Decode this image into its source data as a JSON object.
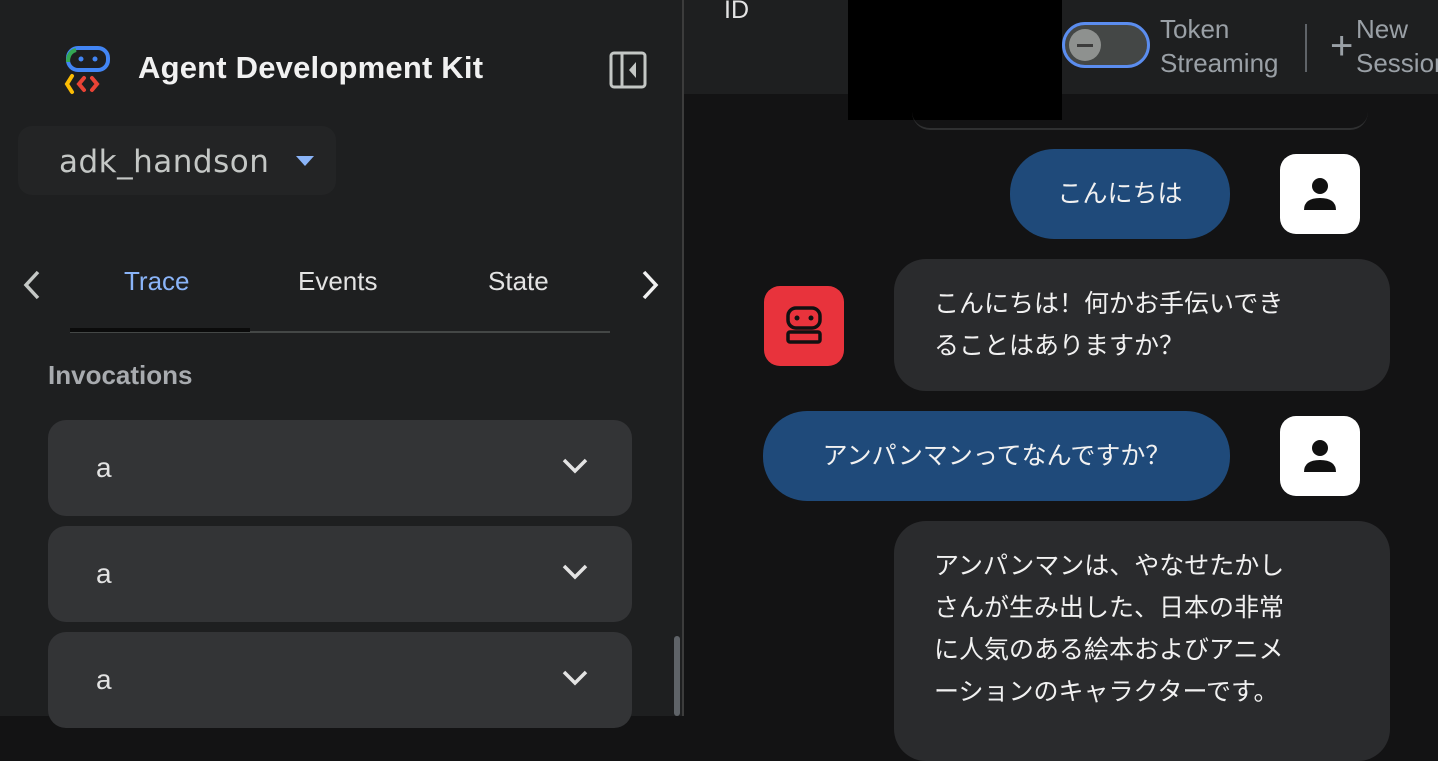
{
  "app": {
    "title": "Agent Development Kit"
  },
  "agent_selector": {
    "value": "adk_handson"
  },
  "tabs": [
    {
      "label": "Trace",
      "active": true
    },
    {
      "label": "Events",
      "active": false
    },
    {
      "label": "State",
      "active": false
    }
  ],
  "invocations": {
    "title": "Invocations",
    "items": [
      {
        "label": "a"
      },
      {
        "label": "a"
      },
      {
        "label": "a"
      }
    ]
  },
  "topbar": {
    "id_label": "ID",
    "token_streaming": {
      "line1": "Token",
      "line2": "Streaming",
      "enabled": false
    },
    "new_session": {
      "line1": "New",
      "line2": "Session"
    }
  },
  "messages": [
    {
      "role": "user",
      "text": "こんにちは"
    },
    {
      "role": "bot",
      "lines": [
        "こんにちは！何かお手伝いでき",
        "ることはありますか？"
      ]
    },
    {
      "role": "user",
      "text": "アンパンマンってなんですか？"
    },
    {
      "role": "bot",
      "lines": [
        "アンパンマンは、やなせたかし",
        "さんが生み出した、日本の非常",
        "に人気のある絵本およびアニメ",
        "ーションのキャラクターです。"
      ]
    }
  ],
  "colors": {
    "accent": "#8ab4f8",
    "user_bubble": "#1f4a7a",
    "bot_avatar": "#e8333c",
    "toggle_border": "#5b8def"
  }
}
